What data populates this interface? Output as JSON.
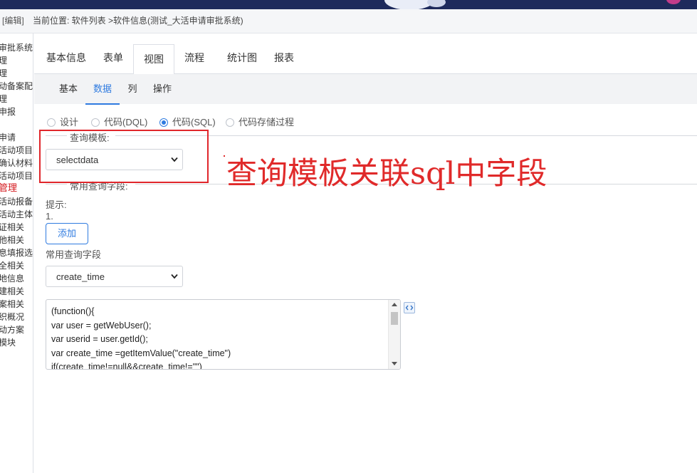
{
  "header": {
    "edit_label": "[编辑]",
    "breadcrumb": "当前位置: 软件列表 >软件信息(测试_大活申请审批系统)"
  },
  "sidebar": {
    "items": [
      "审批系统",
      "理",
      "理",
      "动备案配",
      "理",
      "申报",
      "申请",
      "活动项目创",
      "确认材料",
      "活动项目信",
      "管理",
      "活动报备材",
      "活动主体信",
      "证相关",
      "他相关",
      "息填报选",
      "全相关",
      "地信息",
      "建相关",
      "案相关",
      "织概况",
      "动方案",
      "模块"
    ],
    "active_item": "管理"
  },
  "tabs": [
    "基本信息",
    "表单",
    "视图",
    "流程",
    "统计图",
    "报表"
  ],
  "active_tab": "视图",
  "subtabs": [
    "基本",
    "数据",
    "列",
    "操作"
  ],
  "active_subtab": "数据",
  "mode_options": [
    "设计",
    "代码(DQL)",
    "代码(SQL)",
    "代码存储过程"
  ],
  "selected_mode": "代码(SQL)",
  "query_template": {
    "label": "查询模板:",
    "value": "selectdata"
  },
  "common_fields_legend": "常用查询字段:",
  "hint": {
    "label": "提示:",
    "line": "1."
  },
  "add_button": "添加",
  "common_fields": {
    "label": "常用查询字段",
    "value": "create_time"
  },
  "code_text": "(function(){\nvar user = getWebUser();\nvar userid = user.getId();\nvar create_time =getItemValue(\"create_time\")\nif(create_time!=null&&create_time!=\"\")",
  "annotation": {
    "text": "查询模板关联sql中字段",
    "color": "#e02a2a"
  },
  "colors": {
    "accent": "#2f7be0",
    "highlight_red": "#e0262b",
    "top_bar": "#1e2a5c"
  }
}
